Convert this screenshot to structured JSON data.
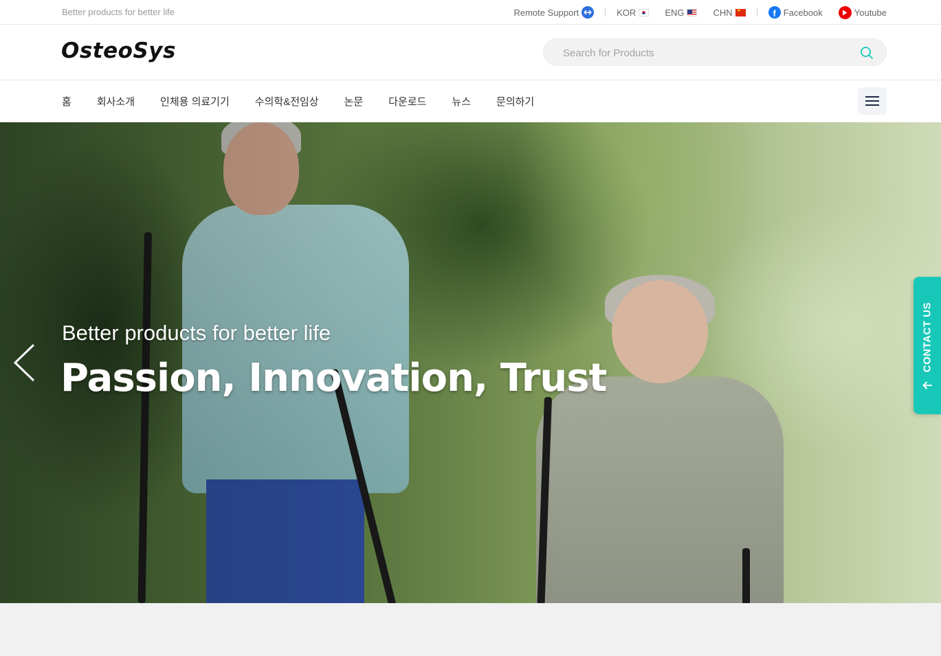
{
  "topbar": {
    "tagline": "Better products for better life",
    "remote_support": "Remote Support",
    "lang_kor": "KOR",
    "lang_eng": "ENG",
    "lang_chn": "CHN",
    "facebook": "Facebook",
    "youtube": "Youtube"
  },
  "header": {
    "logo": "OsteoSys",
    "search_placeholder": "Search for Products"
  },
  "nav": {
    "items": [
      "홈",
      "회사소개",
      "인체용 의료기기",
      "수의학&전임상",
      "논문",
      "다운로드",
      "뉴스",
      "문의하기"
    ]
  },
  "hero": {
    "subtitle": "Better products for better life",
    "title": "Passion, Innovation, Trust"
  },
  "contact": {
    "label": "CONTACT US"
  },
  "colors": {
    "accent": "#17c8b8",
    "facebook": "#1877f2",
    "youtube": "#ee0000",
    "remote_support": "#2f6fdc"
  }
}
